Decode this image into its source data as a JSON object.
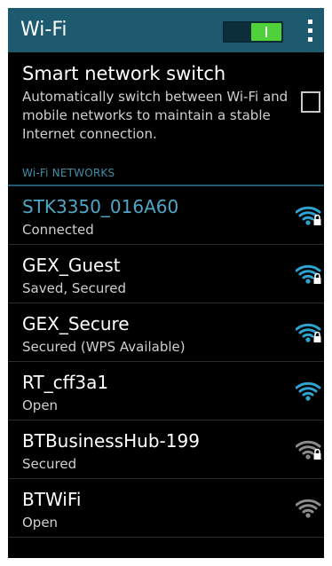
{
  "actionbar": {
    "title": "Wi-Fi",
    "toggle_on": true,
    "menu_icon": "overflow-menu-icon"
  },
  "smart_switch": {
    "title": "Smart network switch",
    "description": "Automatically switch between Wi-Fi and mobile networks to maintain a stable Internet connection.",
    "checked": false
  },
  "section": {
    "header": "Wi-Fi NETWORKS"
  },
  "networks": [
    {
      "name": "STK3350_016A60",
      "status": "Connected",
      "secured": true,
      "connected": true,
      "signal_color": "#2fa3cf"
    },
    {
      "name": "GEX_Guest",
      "status": "Saved, Secured",
      "secured": true,
      "connected": false,
      "signal_color": "#2fa3cf"
    },
    {
      "name": "GEX_Secure",
      "status": "Secured (WPS Available)",
      "secured": true,
      "connected": false,
      "signal_color": "#2fa3cf"
    },
    {
      "name": "RT_cff3a1",
      "status": "Open",
      "secured": false,
      "connected": false,
      "signal_color": "#2fa3cf"
    },
    {
      "name": "BTBusinessHub-199",
      "status": "Secured",
      "secured": true,
      "connected": false,
      "signal_color": "#8a8a8a"
    },
    {
      "name": "BTWiFi",
      "status": "Open",
      "secured": false,
      "connected": false,
      "signal_color": "#8a8a8a"
    }
  ],
  "colors": {
    "actionbar": "#1d5a6f",
    "accent": "#4fa7c6",
    "toggle_on": "#4fd13a"
  }
}
